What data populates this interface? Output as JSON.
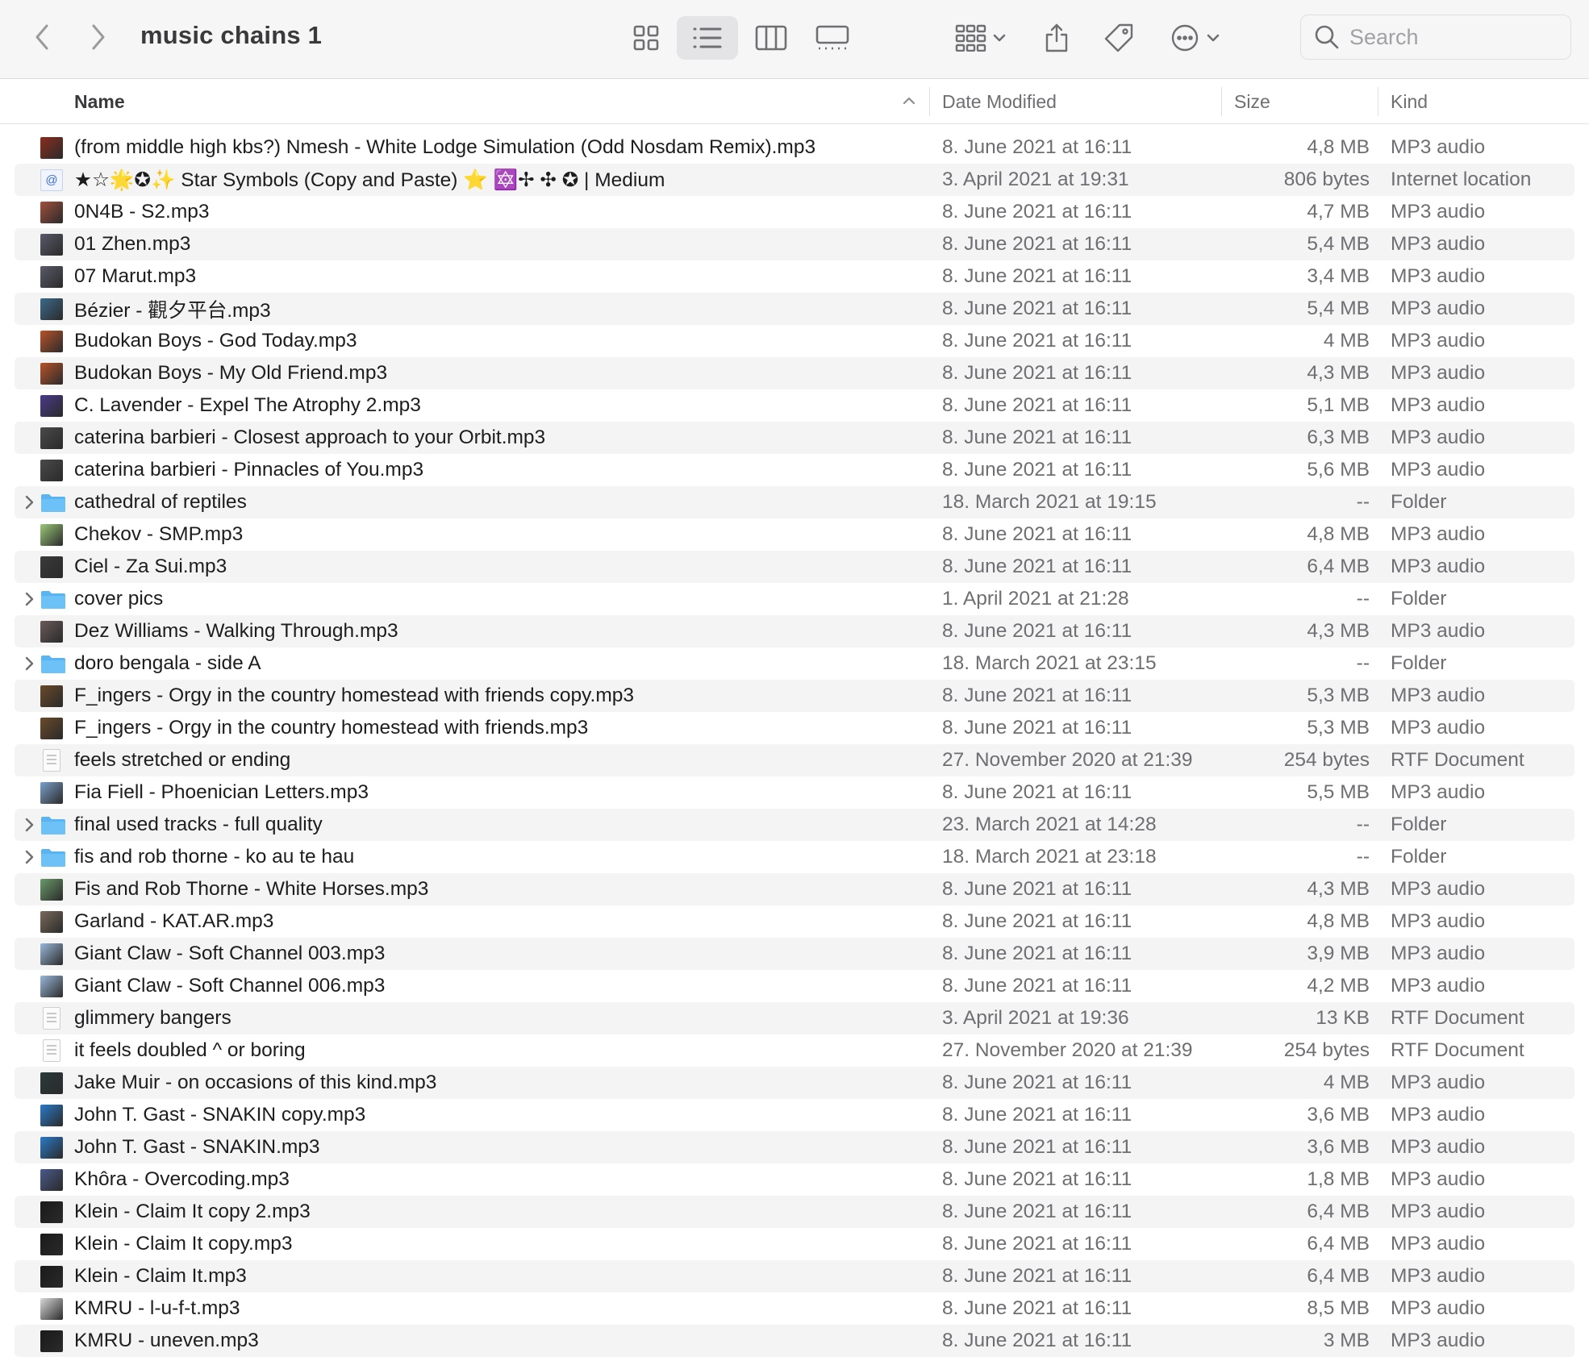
{
  "window": {
    "title": "music chains 1"
  },
  "toolbar": {
    "view_selected": "list",
    "search_placeholder": "Search"
  },
  "columns": {
    "name": "Name",
    "date": "Date Modified",
    "size": "Size",
    "kind": "Kind",
    "sort_direction": "ascending"
  },
  "files": [
    {
      "name": "(from middle high kbs?) Nmesh - White Lodge Simulation (Odd Nosdam Remix).mp3",
      "date": "8. June 2021 at 16:11",
      "size": "4,8 MB",
      "kind": "MP3 audio",
      "icon": "album-art-icon",
      "color": "#8a2d1e"
    },
    {
      "name": "★☆🌟✪✨ Star Symbols (Copy and Paste) ⭐️ 🔯✢ ✣ ✪ | Medium",
      "date": "3. April 2021 at 19:31",
      "size": "806 bytes",
      "kind": "Internet location",
      "icon": "web-location-icon",
      "color": "#3a6fd8"
    },
    {
      "name": "0N4B - S2.mp3",
      "date": "8. June 2021 at 16:11",
      "size": "4,7 MB",
      "kind": "MP3 audio",
      "icon": "album-art-icon",
      "color": "#a0503c"
    },
    {
      "name": "01 Zhen.mp3",
      "date": "8. June 2021 at 16:11",
      "size": "5,4 MB",
      "kind": "MP3 audio",
      "icon": "album-art-icon",
      "color": "#5a5a6a"
    },
    {
      "name": "07 Marut.mp3",
      "date": "8. June 2021 at 16:11",
      "size": "3,4 MB",
      "kind": "MP3 audio",
      "icon": "album-art-icon",
      "color": "#5a5a6a"
    },
    {
      "name": "Bézier - 觀夕平台.mp3",
      "date": "8. June 2021 at 16:11",
      "size": "5,4 MB",
      "kind": "MP3 audio",
      "icon": "album-art-icon",
      "color": "#3d6a8a"
    },
    {
      "name": "Budokan Boys - God Today.mp3",
      "date": "8. June 2021 at 16:11",
      "size": "4 MB",
      "kind": "MP3 audio",
      "icon": "album-art-icon",
      "color": "#b8532a"
    },
    {
      "name": "Budokan Boys - My Old Friend.mp3",
      "date": "8. June 2021 at 16:11",
      "size": "4,3 MB",
      "kind": "MP3 audio",
      "icon": "album-art-icon",
      "color": "#b8532a"
    },
    {
      "name": "C. Lavender - Expel The Atrophy 2.mp3",
      "date": "8. June 2021 at 16:11",
      "size": "5,1 MB",
      "kind": "MP3 audio",
      "icon": "album-art-icon",
      "color": "#4a3a8a"
    },
    {
      "name": "caterina barbieri - Closest approach to your Orbit.mp3",
      "date": "8. June 2021 at 16:11",
      "size": "6,3 MB",
      "kind": "MP3 audio",
      "icon": "album-art-icon",
      "color": "#4a4a4a"
    },
    {
      "name": "caterina barbieri - Pinnacles of You.mp3",
      "date": "8. June 2021 at 16:11",
      "size": "5,6 MB",
      "kind": "MP3 audio",
      "icon": "album-art-icon",
      "color": "#4a4a4a"
    },
    {
      "name": "cathedral of reptiles",
      "date": "18. March 2021 at 19:15",
      "size": "--",
      "kind": "Folder",
      "icon": "folder-icon",
      "color": "#5ab4f0",
      "folder": true
    },
    {
      "name": "Chekov - SMP.mp3",
      "date": "8. June 2021 at 16:11",
      "size": "4,8 MB",
      "kind": "MP3 audio",
      "icon": "album-art-icon",
      "color": "#9ac878"
    },
    {
      "name": "Ciel - Za Sui.mp3",
      "date": "8. June 2021 at 16:11",
      "size": "6,4 MB",
      "kind": "MP3 audio",
      "icon": "album-art-icon",
      "color": "#3a3a3a"
    },
    {
      "name": "cover pics",
      "date": "1. April 2021 at 21:28",
      "size": "--",
      "kind": "Folder",
      "icon": "folder-icon",
      "color": "#5ab4f0",
      "folder": true
    },
    {
      "name": "Dez Williams - Walking Through.mp3",
      "date": "8. June 2021 at 16:11",
      "size": "4,3 MB",
      "kind": "MP3 audio",
      "icon": "album-art-icon",
      "color": "#6a5a5a"
    },
    {
      "name": "doro bengala - side A",
      "date": "18. March 2021 at 23:15",
      "size": "--",
      "kind": "Folder",
      "icon": "folder-icon",
      "color": "#5ab4f0",
      "folder": true
    },
    {
      "name": "F_ingers - Orgy in the country homestead with friends copy.mp3",
      "date": "8. June 2021 at 16:11",
      "size": "5,3 MB",
      "kind": "MP3 audio",
      "icon": "album-art-icon",
      "color": "#6a4a2a"
    },
    {
      "name": "F_ingers - Orgy in the country homestead with friends.mp3",
      "date": "8. June 2021 at 16:11",
      "size": "5,3 MB",
      "kind": "MP3 audio",
      "icon": "album-art-icon",
      "color": "#6a4a2a"
    },
    {
      "name": "feels stretched or ending",
      "date": "27. November 2020 at 21:39",
      "size": "254 bytes",
      "kind": "RTF Document",
      "icon": "document-icon",
      "color": "#ffffff",
      "doc": true
    },
    {
      "name": "Fia Fiell - Phoenician Letters.mp3",
      "date": "8. June 2021 at 16:11",
      "size": "5,5 MB",
      "kind": "MP3 audio",
      "icon": "album-art-icon",
      "color": "#7aa0c8"
    },
    {
      "name": "final used tracks - full quality",
      "date": "23. March 2021 at 14:28",
      "size": "--",
      "kind": "Folder",
      "icon": "folder-icon",
      "color": "#5ab4f0",
      "folder": true
    },
    {
      "name": "fis and rob thorne - ko au te hau",
      "date": "18. March 2021 at 23:18",
      "size": "--",
      "kind": "Folder",
      "icon": "folder-icon",
      "color": "#5ab4f0",
      "folder": true
    },
    {
      "name": "Fis and Rob Thorne - White Horses.mp3",
      "date": "8. June 2021 at 16:11",
      "size": "4,3 MB",
      "kind": "MP3 audio",
      "icon": "album-art-icon",
      "color": "#6a9a6a"
    },
    {
      "name": "Garland - KAT.AR.mp3",
      "date": "8. June 2021 at 16:11",
      "size": "4,8 MB",
      "kind": "MP3 audio",
      "icon": "album-art-icon",
      "color": "#7a6a5a"
    },
    {
      "name": "Giant Claw - Soft Channel 003.mp3",
      "date": "8. June 2021 at 16:11",
      "size": "3,9 MB",
      "kind": "MP3 audio",
      "icon": "album-art-icon",
      "color": "#9ab8d8"
    },
    {
      "name": "Giant Claw - Soft Channel 006.mp3",
      "date": "8. June 2021 at 16:11",
      "size": "4,2 MB",
      "kind": "MP3 audio",
      "icon": "album-art-icon",
      "color": "#9ab8d8"
    },
    {
      "name": "glimmery bangers",
      "date": "3. April 2021 at 19:36",
      "size": "13 KB",
      "kind": "RTF Document",
      "icon": "document-icon",
      "color": "#ffffff",
      "doc": true
    },
    {
      "name": "it feels doubled ^ or boring",
      "date": "27. November 2020 at 21:39",
      "size": "254 bytes",
      "kind": "RTF Document",
      "icon": "document-icon",
      "color": "#ffffff",
      "doc": true
    },
    {
      "name": "Jake Muir - on occasions of this kind.mp3",
      "date": "8. June 2021 at 16:11",
      "size": "4 MB",
      "kind": "MP3 audio",
      "icon": "album-art-icon",
      "color": "#2a3a3a"
    },
    {
      "name": "John T. Gast - SNAKIN copy.mp3",
      "date": "8. June 2021 at 16:11",
      "size": "3,6 MB",
      "kind": "MP3 audio",
      "icon": "album-art-icon",
      "color": "#2a7ac8"
    },
    {
      "name": "John T. Gast - SNAKIN.mp3",
      "date": "8. June 2021 at 16:11",
      "size": "3,6 MB",
      "kind": "MP3 audio",
      "icon": "album-art-icon",
      "color": "#2a7ac8"
    },
    {
      "name": "Khôra - Overcoding.mp3",
      "date": "8. June 2021 at 16:11",
      "size": "1,8 MB",
      "kind": "MP3 audio",
      "icon": "album-art-icon",
      "color": "#4a5a8a"
    },
    {
      "name": "Klein - Claim It copy 2.mp3",
      "date": "8. June 2021 at 16:11",
      "size": "6,4 MB",
      "kind": "MP3 audio",
      "icon": "album-art-icon",
      "color": "#1a1a1a"
    },
    {
      "name": "Klein - Claim It copy.mp3",
      "date": "8. June 2021 at 16:11",
      "size": "6,4 MB",
      "kind": "MP3 audio",
      "icon": "album-art-icon",
      "color": "#1a1a1a"
    },
    {
      "name": "Klein - Claim It.mp3",
      "date": "8. June 2021 at 16:11",
      "size": "6,4 MB",
      "kind": "MP3 audio",
      "icon": "album-art-icon",
      "color": "#1a1a1a"
    },
    {
      "name": "KMRU - l-u-f-t.mp3",
      "date": "8. June 2021 at 16:11",
      "size": "8,5 MB",
      "kind": "MP3 audio",
      "icon": "album-art-icon",
      "color": "#d8d8d8"
    },
    {
      "name": "KMRU - uneven.mp3",
      "date": "8. June 2021 at 16:11",
      "size": "3 MB",
      "kind": "MP3 audio",
      "icon": "album-art-icon",
      "color": "#1a1a1a"
    }
  ]
}
